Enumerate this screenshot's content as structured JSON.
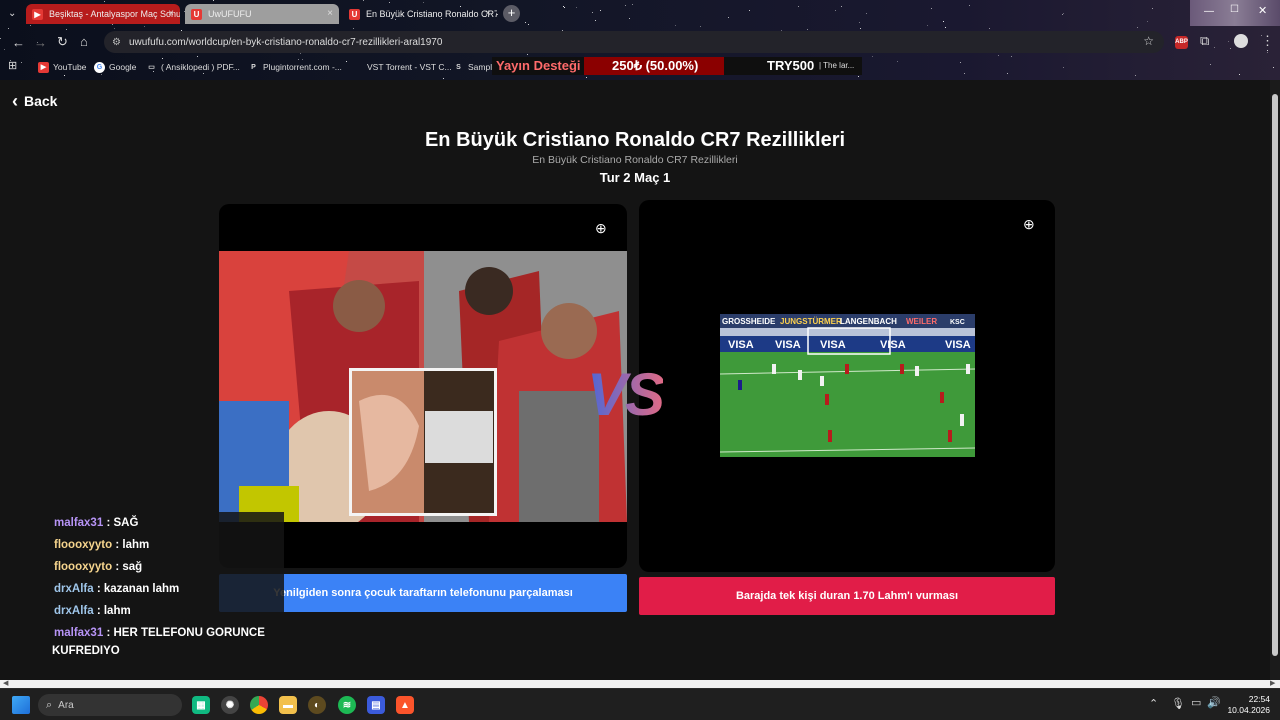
{
  "browser": {
    "tabs": [
      {
        "title": "Beşiktaş - Antalyaspor Maç Sonu",
        "close": "×",
        "favicon": "youtube-icon",
        "color": "#e53935"
      },
      {
        "title": "UwUFUFU",
        "close": "×",
        "favicon": "uwufufu-icon",
        "color": "#e53935"
      },
      {
        "title": "En Büyük Cristiano Ronaldo CR7",
        "close": "×",
        "favicon": "uwufufu-icon",
        "color": "#e53935"
      }
    ],
    "new_tab": "+",
    "url": "uwufufu.com/worldcup/en-byk-cristiano-ronaldo-cr7-rezillikleri-aral1970",
    "bookmarks": [
      {
        "label": "YouTube",
        "icon": "youtube-icon"
      },
      {
        "label": "Google",
        "icon": "google-icon"
      },
      {
        "label": "( Ansiklopedi ) PDF...",
        "icon": "file-icon"
      },
      {
        "label": "Plugintorrent.com -...",
        "icon": "p-icon"
      },
      {
        "label": "VST Torrent - VST C...",
        "icon": "vst-icon"
      },
      {
        "label": "Sample",
        "icon": "s-icon"
      }
    ],
    "ticker": {
      "title": "Yayın Desteği",
      "amount": "250₺ (50.00%)",
      "goal": "TRY500",
      "extra": "| The lar..."
    }
  },
  "page": {
    "back_label": "Back",
    "title": "En Büyük Cristiano Ronaldo CR7 Rezillikleri",
    "subtitle": "En Büyük Cristiano Ronaldo CR7 Rezillikleri",
    "round": "Tur 2 Maç 1",
    "vs": "VS",
    "left_choice": "Yenilgiden sonra çocuk taraftarın telefonunu parçalaması",
    "right_choice": "Barajda tek kişi duran 1.70 Lahm'ı vurması",
    "colors": {
      "left": "#3b82f6",
      "right": "#e11d48"
    },
    "billboard_text": [
      "GROSSHEIDE",
      "JUNGSTÜRMER",
      "LANGENBACH",
      "WEILER",
      "KSC"
    ],
    "ad_text": [
      "VISA",
      "VISA",
      "VISA",
      "VISA",
      "VISA"
    ]
  },
  "chat": [
    {
      "user": "malfax31",
      "text": ": SAĞ",
      "color": "#b794f6"
    },
    {
      "user": "floooxyyto",
      "text": ": lahm",
      "color": "#f6d58e"
    },
    {
      "user": "floooxyyto",
      "text": ": sağ",
      "color": "#f6d58e"
    },
    {
      "user": "drxAlfa",
      "text": ": kazanan lahm",
      "color": "#9fc6ea"
    },
    {
      "user": "drxAlfa",
      "text": ": lahm",
      "color": "#9fc6ea"
    },
    {
      "user": "malfax31",
      "text": ": HER TELEFONU GORUNCE",
      "color": "#b794f6"
    }
  ],
  "chat_wrap": "KUFREDIYO",
  "taskbar": {
    "search_placeholder": "Ara",
    "time": "22:54",
    "date": "10.04.2026"
  }
}
